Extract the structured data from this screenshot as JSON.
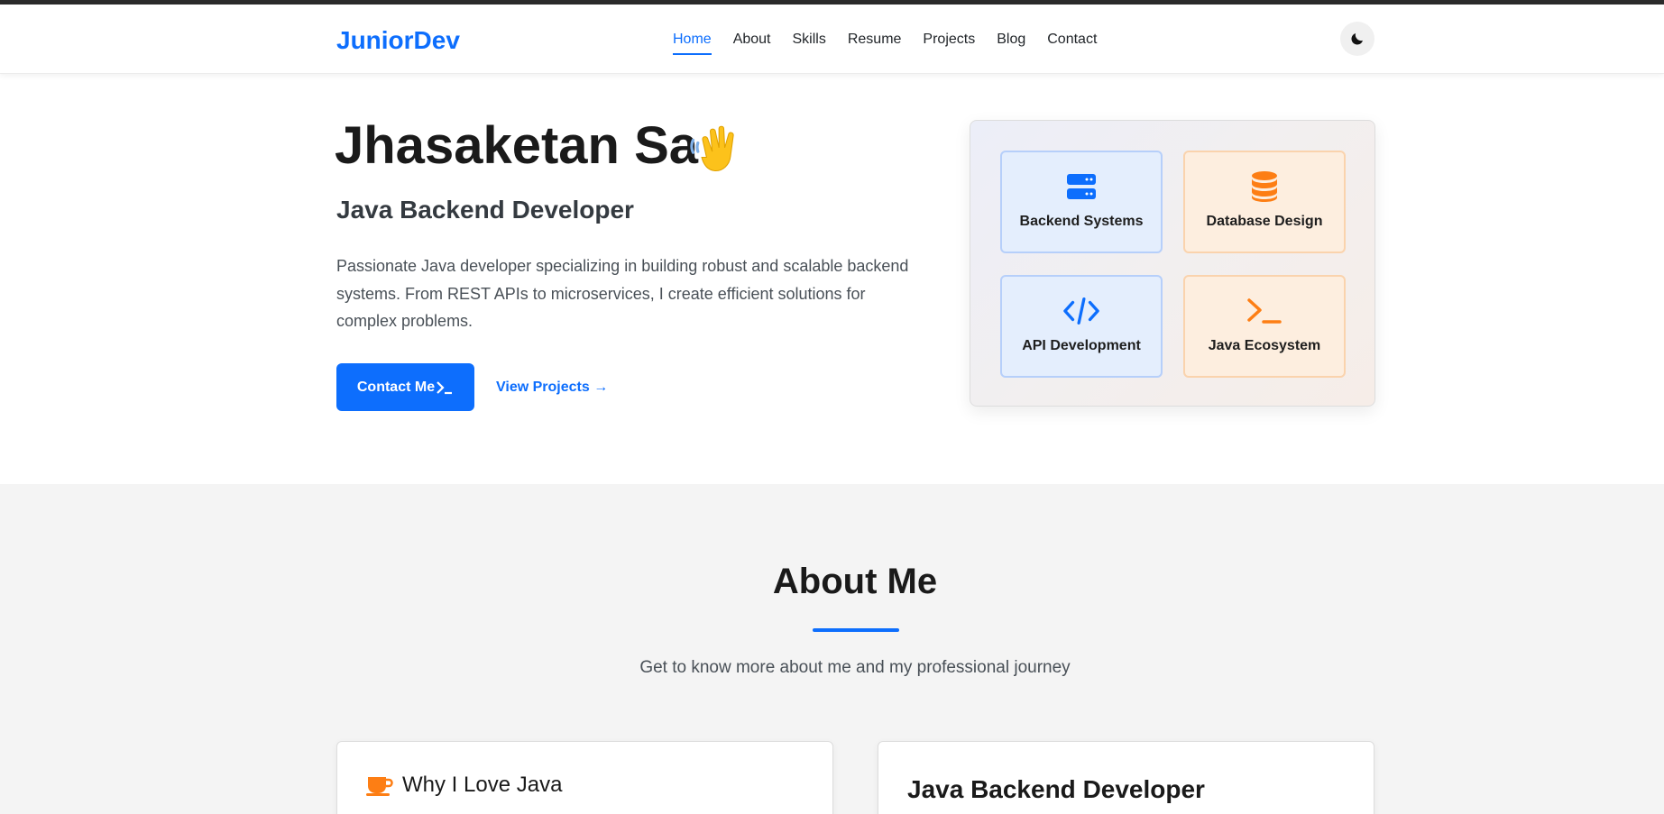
{
  "nav": {
    "brand": "JuniorDev",
    "links": [
      "Home",
      "About",
      "Skills",
      "Resume",
      "Projects",
      "Blog",
      "Contact"
    ],
    "active": "Home",
    "theme_icon": "moon-icon"
  },
  "hero": {
    "name": "Jhasaketan Sa",
    "emoji_icon": "waving-hand-icon",
    "role": "Java Backend Developer",
    "description": "Passionate Java developer specializing in building robust and scalable backend systems. From REST APIs to microservices, I create efficient solutions for complex problems.",
    "primary_button": "Contact Me",
    "secondary_link": "View Projects →"
  },
  "tiles": [
    {
      "label": "Backend Systems",
      "icon": "server-icon",
      "color": "#0d6efd"
    },
    {
      "label": "Database Design",
      "icon": "database-icon",
      "color": "#fd7e14"
    },
    {
      "label": "API Development",
      "icon": "code-icon",
      "color": "#0d6efd"
    },
    {
      "label": "Java Ecosystem",
      "icon": "terminal-icon",
      "color": "#fd7e14"
    }
  ],
  "about": {
    "title": "About Me",
    "subtitle": "Get to know more about me and my professional journey",
    "card_left_title": "Why I Love Java",
    "card_left_icon": "coffee-cup-icon",
    "card_right_title": "Java Backend Developer"
  }
}
